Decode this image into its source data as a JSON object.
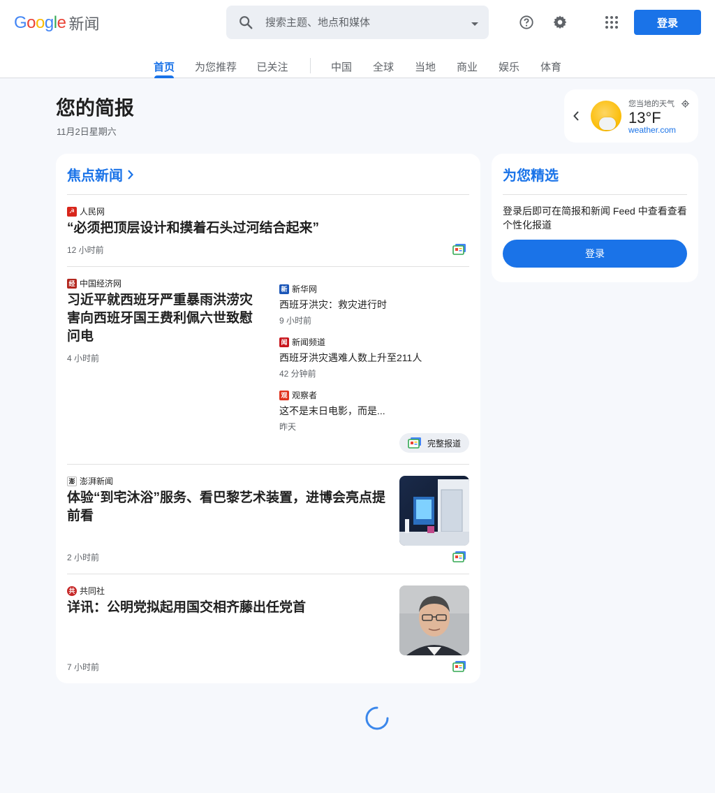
{
  "header": {
    "logo_text": "Google",
    "product_name": "新闻",
    "search_placeholder": "搜索主题、地点和媒体",
    "signin_label": "登录"
  },
  "tabs": [
    {
      "label": "首页",
      "active": true
    },
    {
      "label": "为您推荐"
    },
    {
      "label": "已关注"
    },
    {
      "label": "中国"
    },
    {
      "label": "全球"
    },
    {
      "label": "当地"
    },
    {
      "label": "商业"
    },
    {
      "label": "娱乐"
    },
    {
      "label": "体育"
    }
  ],
  "briefing": {
    "title": "您的简报",
    "date": "11月2日星期六"
  },
  "weather": {
    "label": "您当地的天气",
    "temp": "13°F",
    "source": "weather.com"
  },
  "top_stories": {
    "title": "焦点新闻",
    "story1": {
      "source": "人民网",
      "headline": "“必须把顶层设计和摸着石头过河结合起来”",
      "time": "12 小时前"
    },
    "story2": {
      "source": "中国经济网",
      "headline": "习近平就西班牙严重暴雨洪涝灾害向西班牙国王费利佩六世致慰问电",
      "time": "4 小时前",
      "related": [
        {
          "source": "新华网",
          "headline": "西班牙洪灾：救灾进行时",
          "time": "9 小时前"
        },
        {
          "source": "新闻频道",
          "headline": "西班牙洪灾遇难人数上升至211人",
          "time": "42 分钟前"
        },
        {
          "source": "观察者",
          "headline": "这不是末日电影，而是...",
          "time": "昨天"
        }
      ],
      "full_coverage": "完整报道"
    },
    "story3": {
      "source": "澎湃新闻",
      "headline": "体验“到宅沐浴”服务、看巴黎艺术装置，进博会亮点提前看",
      "time": "2 小时前"
    },
    "story4": {
      "source": "共同社",
      "headline": "详讯：公明党拟起用国交相齐藤出任党首",
      "time": "7 小时前"
    }
  },
  "for_you": {
    "title": "为您精选",
    "text": "登录后即可在简报和新闻 Feed 中查看查看个性化报道",
    "button": "登录"
  },
  "colors": {
    "accent": "#1a73e8",
    "background": "#f6f8fc"
  }
}
